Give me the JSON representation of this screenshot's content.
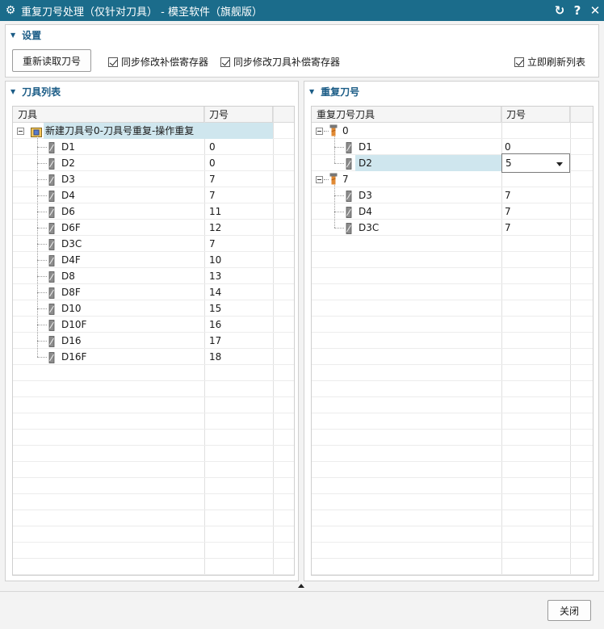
{
  "window": {
    "title": "重复刀号处理（仅针对刀具） - 模圣软件（旗舰版）"
  },
  "settings": {
    "header": "设置",
    "reload_button": "重新读取刀号",
    "checkboxes": [
      {
        "label": "同步修改补偿寄存器",
        "checked": true
      },
      {
        "label": "同步修改刀具补偿寄存器",
        "checked": true
      },
      {
        "label": "立即刷新列表",
        "checked": true
      }
    ]
  },
  "tool_list": {
    "header": "刀具列表",
    "columns": [
      "刀具",
      "刀号"
    ],
    "root": "新建刀具号0-刀具号重复-操作重复",
    "rows": [
      {
        "tool": "D1",
        "num": "0"
      },
      {
        "tool": "D2",
        "num": "0"
      },
      {
        "tool": "D3",
        "num": "7"
      },
      {
        "tool": "D4",
        "num": "7"
      },
      {
        "tool": "D6",
        "num": "11"
      },
      {
        "tool": "D6F",
        "num": "12"
      },
      {
        "tool": "D3C",
        "num": "7"
      },
      {
        "tool": "D4F",
        "num": "10"
      },
      {
        "tool": "D8",
        "num": "13"
      },
      {
        "tool": "D8F",
        "num": "14"
      },
      {
        "tool": "D10",
        "num": "15"
      },
      {
        "tool": "D10F",
        "num": "16"
      },
      {
        "tool": "D16",
        "num": "17"
      },
      {
        "tool": "D16F",
        "num": "18"
      }
    ]
  },
  "dup_list": {
    "header": "重复刀号",
    "columns": [
      "重复刀号刀具",
      "刀号"
    ],
    "groups": [
      {
        "label": "0",
        "items": [
          {
            "tool": "D1",
            "num": "0"
          },
          {
            "tool": "D2",
            "num": "5"
          }
        ]
      },
      {
        "label": "7",
        "items": [
          {
            "tool": "D3",
            "num": "7"
          },
          {
            "tool": "D4",
            "num": "7"
          },
          {
            "tool": "D3C",
            "num": "7"
          }
        ]
      }
    ]
  },
  "footer": {
    "close_button": "关闭"
  },
  "colors": {
    "titlebar": "#1b6c8b",
    "accent": "#1b5c86",
    "selection": "#cfe6ee"
  }
}
